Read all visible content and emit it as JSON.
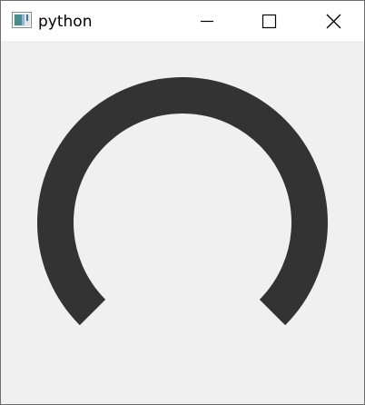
{
  "window": {
    "title": "python",
    "app_icon": "python-app-icon",
    "controls": {
      "minimize_icon": "minimize-icon",
      "maximize_icon": "maximize-icon",
      "close_icon": "close-icon"
    }
  },
  "dial": {
    "value_fraction": 0.75,
    "arc_color": "#333333",
    "background_color": "#f0f0f0"
  }
}
